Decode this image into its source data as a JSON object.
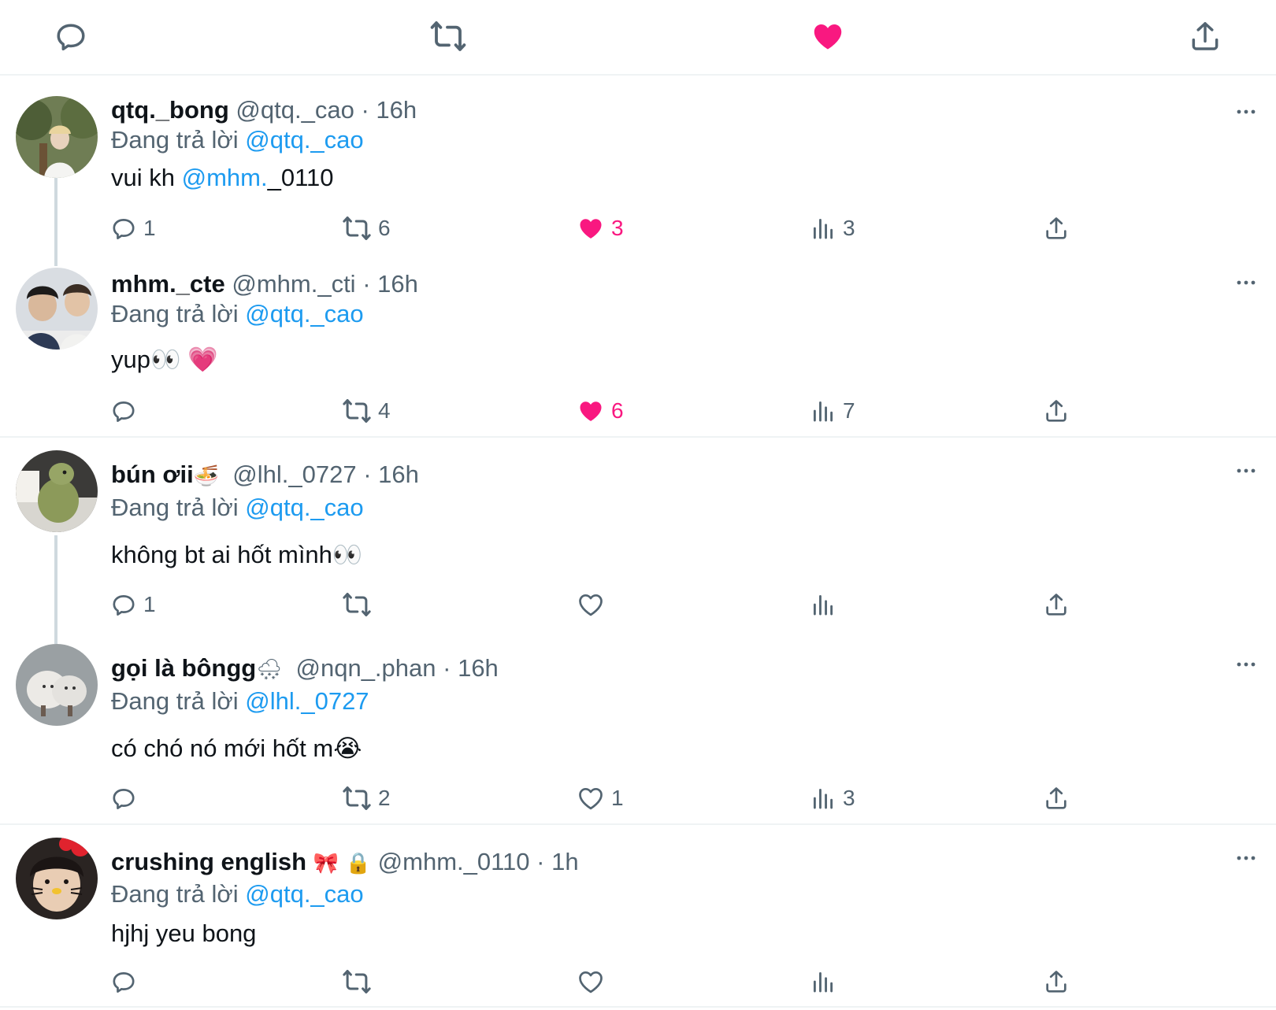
{
  "colors": {
    "accent": "#1d9bf0",
    "like": "#f91880",
    "muted": "#536471",
    "text": "#0f1419",
    "border": "#eff3f4"
  },
  "top_actions": [
    "reply-icon",
    "retweet-icon",
    "heart-filled-icon",
    "share-icon"
  ],
  "replying_prefix": "Đang trả lời",
  "tweets": [
    {
      "name": "qtq._bong",
      "name_emoji": "",
      "handle": "@qtq._cao",
      "time": "· 16h",
      "replying_to": "@qtq._cao",
      "text_before": "vui kh ",
      "mention": "@mhm.",
      "text_after": "_0110",
      "replies": "1",
      "retweets": "6",
      "likes": "3",
      "views": "3",
      "liked": true
    },
    {
      "name": "mhm._cte",
      "name_emoji": "",
      "handle": "@mhm._cti",
      "time": "· 16h",
      "replying_to": "@qtq._cao",
      "text": "yup👀 💗",
      "replies": "",
      "retweets": "4",
      "likes": "6",
      "views": "7",
      "liked": true
    },
    {
      "name": "bún ơii",
      "name_emoji": "🍜",
      "handle": "@lhl._0727",
      "time": "· 16h",
      "replying_to": "@qtq._cao",
      "text": "không bt ai hốt mình👀",
      "replies": "1",
      "retweets": "",
      "likes": "",
      "views": "",
      "liked": false
    },
    {
      "name": "gọi là bôngg",
      "name_emoji": "🌨",
      "handle": "@nqn_.phan",
      "time": "· 16h",
      "replying_to": "@lhl._0727",
      "text": "có chó nó mới hốt m😭",
      "replies": "",
      "retweets": "2",
      "likes": "1",
      "views": "3",
      "liked": false
    },
    {
      "name": "crushing english",
      "name_emoji": "🎀",
      "lock": "🔒",
      "handle": "@mhm._0110",
      "time": "· 1h",
      "replying_to": "@qtq._cao",
      "text": "hjhj yeu bong",
      "replies": "",
      "retweets": "",
      "likes": "",
      "views": "",
      "liked": false
    }
  ]
}
